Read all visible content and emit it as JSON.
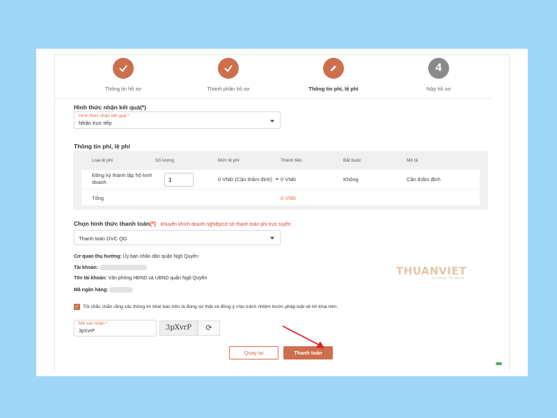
{
  "steps": [
    {
      "label": "Thông tin hồ sơ",
      "state": "done",
      "icon": "check-icon"
    },
    {
      "label": "Thành phần hồ sơ",
      "state": "done",
      "icon": "check-icon"
    },
    {
      "label": "Thông tin phí, lệ phí",
      "state": "active",
      "icon": "pencil-icon"
    },
    {
      "label": "Nộp hồ sơ",
      "state": "todo",
      "number": "4"
    }
  ],
  "result_method": {
    "section_title": "Hình thức nhận kết quả",
    "required_mark": "(*)",
    "float_label": "Hình thức nhận kết quả *",
    "value": "Nhận trực tiếp"
  },
  "fees": {
    "section_title": "Thông tin phí, lệ phí",
    "headers": [
      "Loại lệ phí",
      "Số lượng",
      "Mức lệ phí",
      "Thành tiền",
      "Bắt buộc",
      "Mô tả"
    ],
    "row": {
      "type_line1": "Đăng ký thành lập hộ kinh",
      "type_line2": "doanh",
      "quantity": "1",
      "rate": "0 VNĐ (Cần thẩm định)",
      "amount": "0 VNĐ",
      "required": "Không",
      "description": "Cần thẩm định"
    },
    "total_label": "Tổng",
    "total_value": "0 VNĐ"
  },
  "payment": {
    "section_title": "Chọn hình thức thanh toán",
    "required_mark": "(*)",
    "hint": "Khuyến khích doanh nghiệp/cơ sở thanh toán phí trực tuyến",
    "value": "Thanh toán DVC QG"
  },
  "beneficiary": {
    "agency_label": "Cơ quan thụ hưởng:",
    "agency_value": "Ủy ban nhân dân quận Ngô Quyền",
    "account_label": "Tài khoản:",
    "account_name_label": "Tên tài khoản:",
    "account_name_value": "Văn phòng HĐND và UBND quận Ngô Quyền",
    "bank_code_label": "Mã ngân hàng:"
  },
  "commitment": {
    "checked": true,
    "text": "Tôi chắc chắn rằng các thông tin khai báo trên là đúng sự thật và đồng ý chịu trách nhiệm trước pháp luật về lời khai trên."
  },
  "captcha": {
    "float_label": "Mã xác nhận *",
    "value": "3pXvrP",
    "image_text": "3pXvrP"
  },
  "buttons": {
    "back": "Quay lại",
    "pay": "Thanh toán"
  },
  "watermark": {
    "brand": "THUANVIET",
    "tagline": "Accounting · Tax Services"
  },
  "colors": {
    "accent": "#cd6f4d",
    "inactive_step": "#8a8a8a",
    "background": "#9fd7f8",
    "required_red": "#e23b2e",
    "arrow_red": "#e02020"
  }
}
